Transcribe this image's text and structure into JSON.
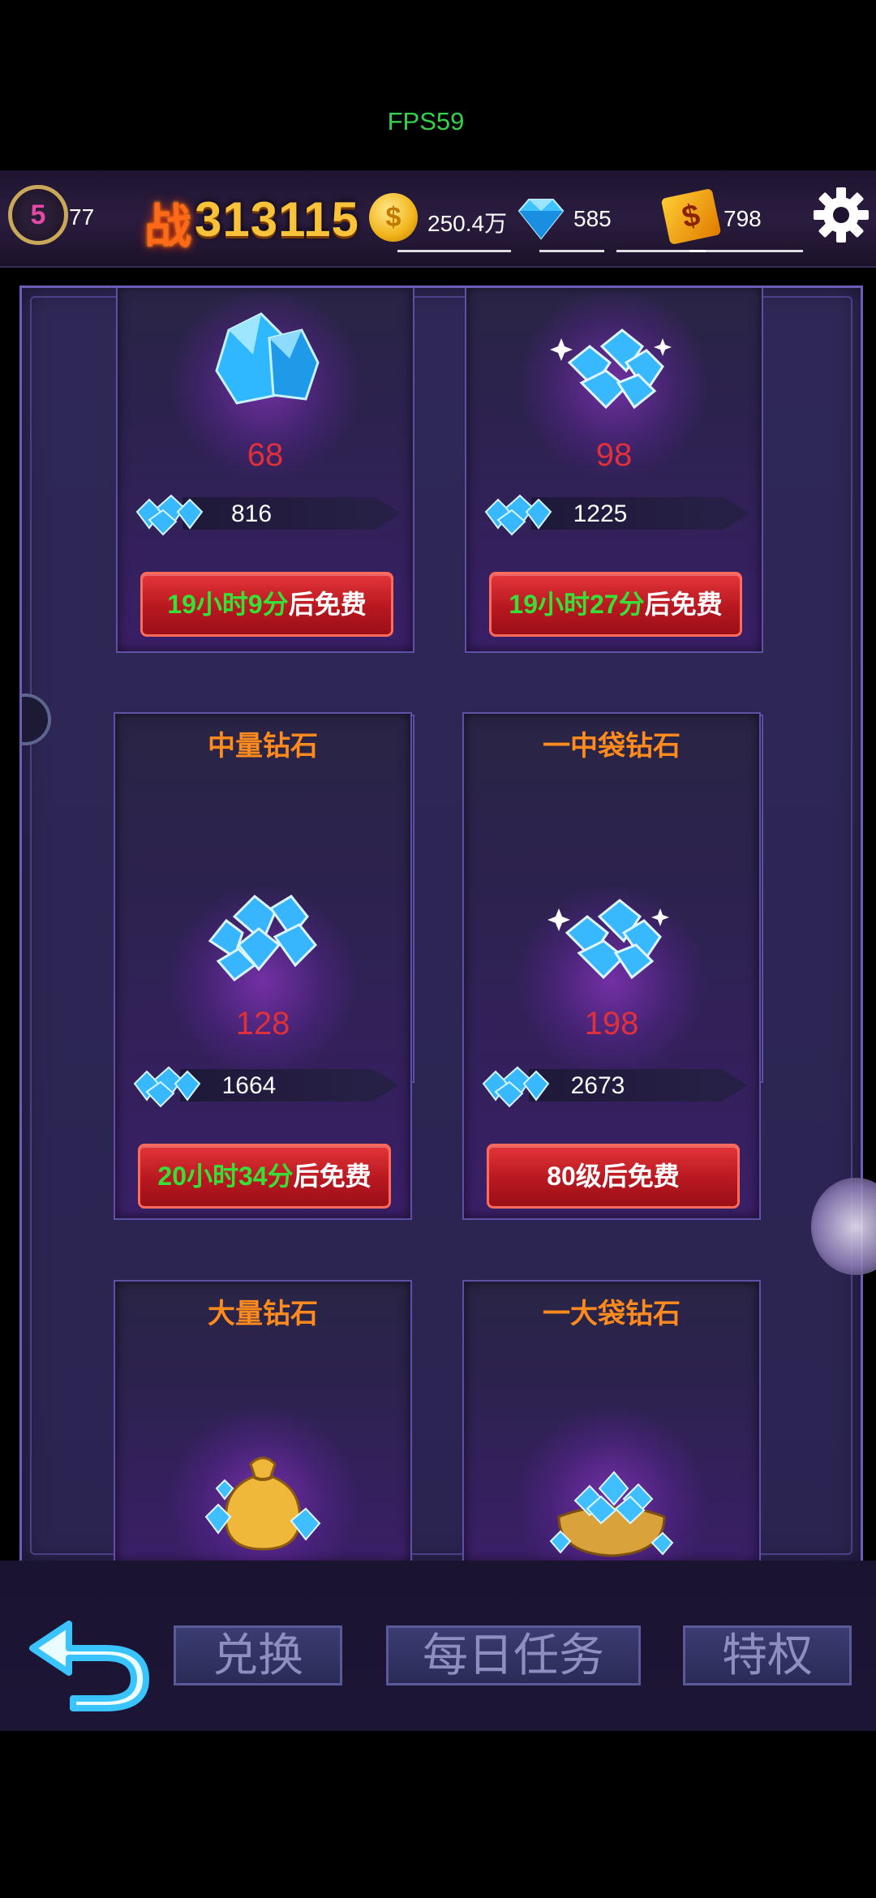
{
  "fps": "FPS59",
  "topbar": {
    "level": "5",
    "level_value": "77",
    "power_icon": "战",
    "power": "313115",
    "coins": "250.4万",
    "diamonds": "585",
    "tickets": "798",
    "icons": [
      "level-badge-icon",
      "flame-power-icon",
      "gold-coin-icon",
      "diamond-icon",
      "ticket-icon",
      "gear-icon"
    ]
  },
  "cards": [
    {
      "title": "",
      "price": "68",
      "quantity": "816",
      "free_time": "19小时9分",
      "free_suffix": "后免费"
    },
    {
      "title": "",
      "price": "98",
      "quantity": "1225",
      "free_time": "19小时27分",
      "free_suffix": "后免费"
    },
    {
      "title": "中量钻石",
      "price": "128",
      "quantity": "1664",
      "free_time": "20小时34分",
      "free_suffix": "后免费"
    },
    {
      "title": "一中袋钻石",
      "price": "198",
      "quantity": "2673",
      "free_time": "",
      "free_suffix": "80级后免费"
    },
    {
      "title": "大量钻石"
    },
    {
      "title": "一大袋钻石"
    }
  ],
  "nav": {
    "exchange": "兑换",
    "daily_tasks": "每日任务",
    "privilege": "特权"
  },
  "colors": {
    "price_red": "#e0303a",
    "title_orange": "#ff8a1e",
    "timer_green": "#37e038",
    "button_red": "#c51c24",
    "panel_purple": "#2f2857"
  }
}
